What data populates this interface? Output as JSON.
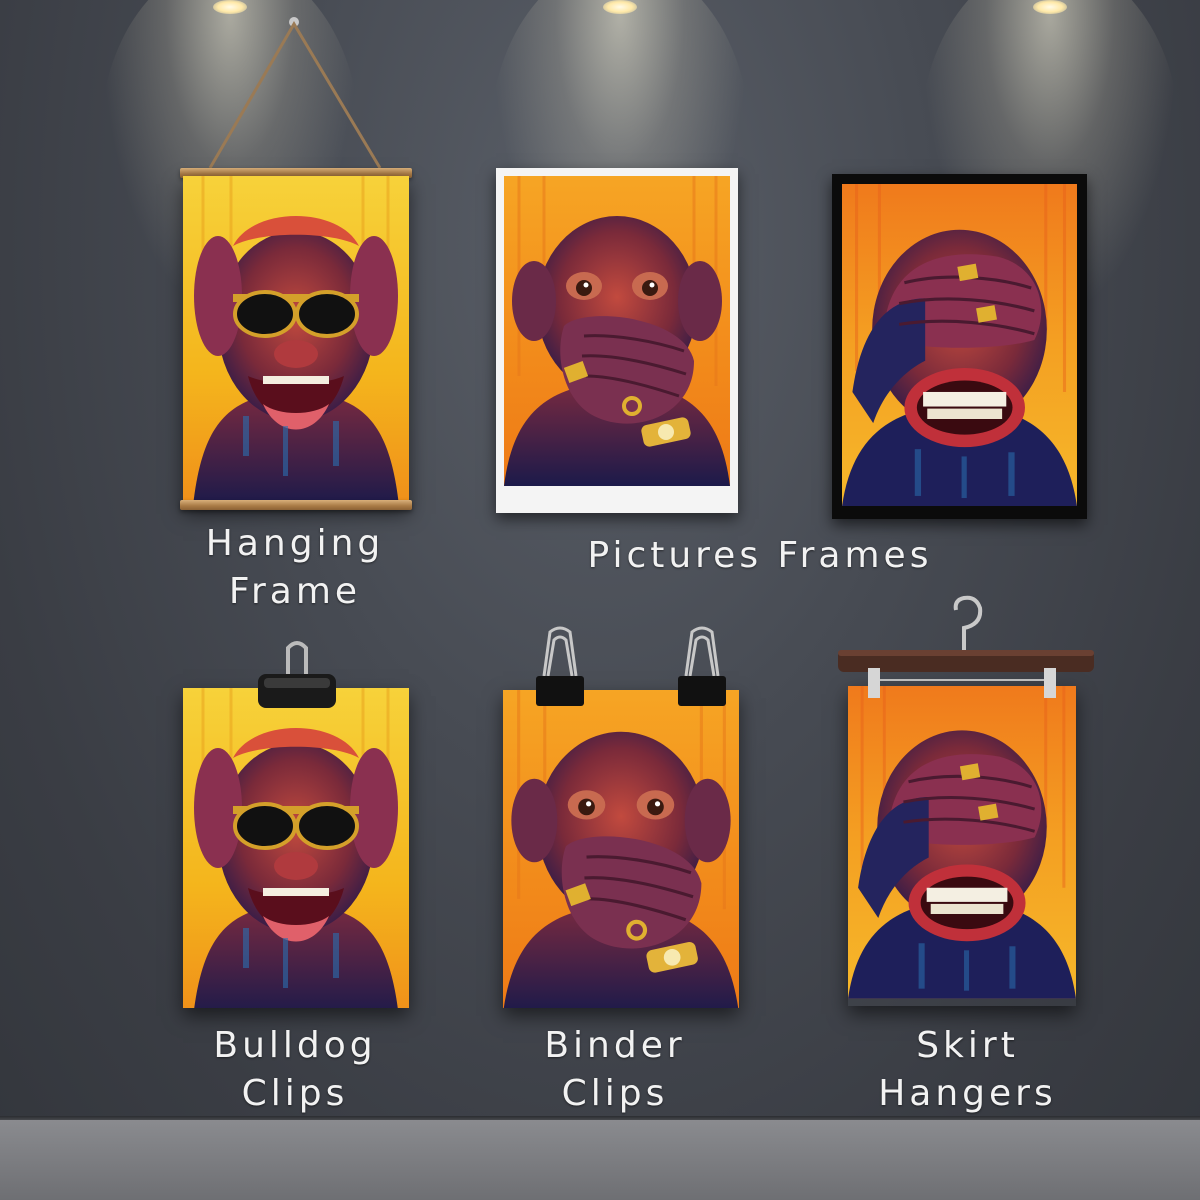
{
  "captions": {
    "hanging": "Hanging\nFrame",
    "pictures": "Pictures Frames",
    "bulldog": "Bulldog\nClips",
    "binder": "Binder\nClips",
    "skirt": "Skirt\nHangers"
  },
  "colors": {
    "wall": "#474b53",
    "floor": "#7c7d81",
    "art_yellow": "#f5c21c",
    "art_orange": "#f08a1a",
    "art_red": "#e8541e",
    "wood": "#b88a50"
  },
  "artworks": [
    {
      "subject": "monkey-sunglasses-laughing",
      "icon": "monkey-sunglasses-art"
    },
    {
      "subject": "monkey-covering-mouth",
      "icon": "monkey-speak-no-evil-art"
    },
    {
      "subject": "monkey-covering-eyes",
      "icon": "monkey-see-no-evil-art"
    }
  ]
}
